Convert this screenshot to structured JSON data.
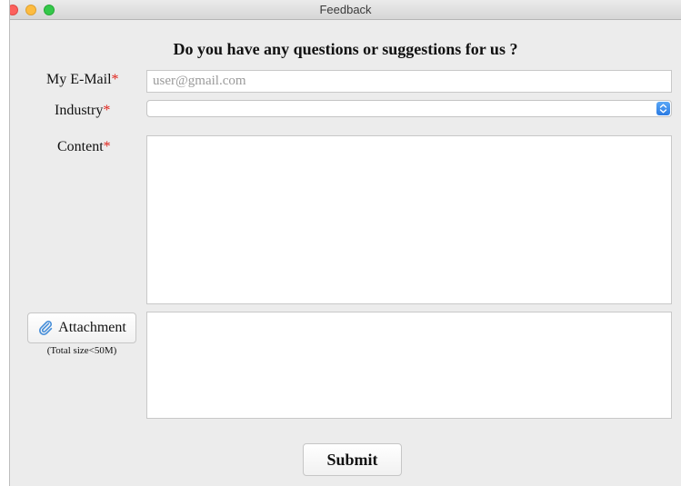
{
  "window": {
    "title": "Feedback"
  },
  "form": {
    "heading": "Do you have any questions or suggestions for us ?",
    "required_mark": "*",
    "email": {
      "label": "My E-Mail",
      "value": "",
      "placeholder": "user@gmail.com"
    },
    "industry": {
      "label": "Industry",
      "selected": ""
    },
    "content": {
      "label": "Content",
      "value": ""
    },
    "attachment": {
      "button_label": "Attachment",
      "note": "(Total size<50M)"
    },
    "submit_label": "Submit"
  },
  "colors": {
    "required": "#e0231b",
    "close": "#fc605c",
    "minimize": "#fdbc40",
    "maximize": "#34c84a",
    "select_accent": "#2a7ae2",
    "attachment_icon": "#4a90d9"
  },
  "icons": {
    "attachment": "paperclip-icon",
    "select": "chevron-up-down-icon"
  }
}
